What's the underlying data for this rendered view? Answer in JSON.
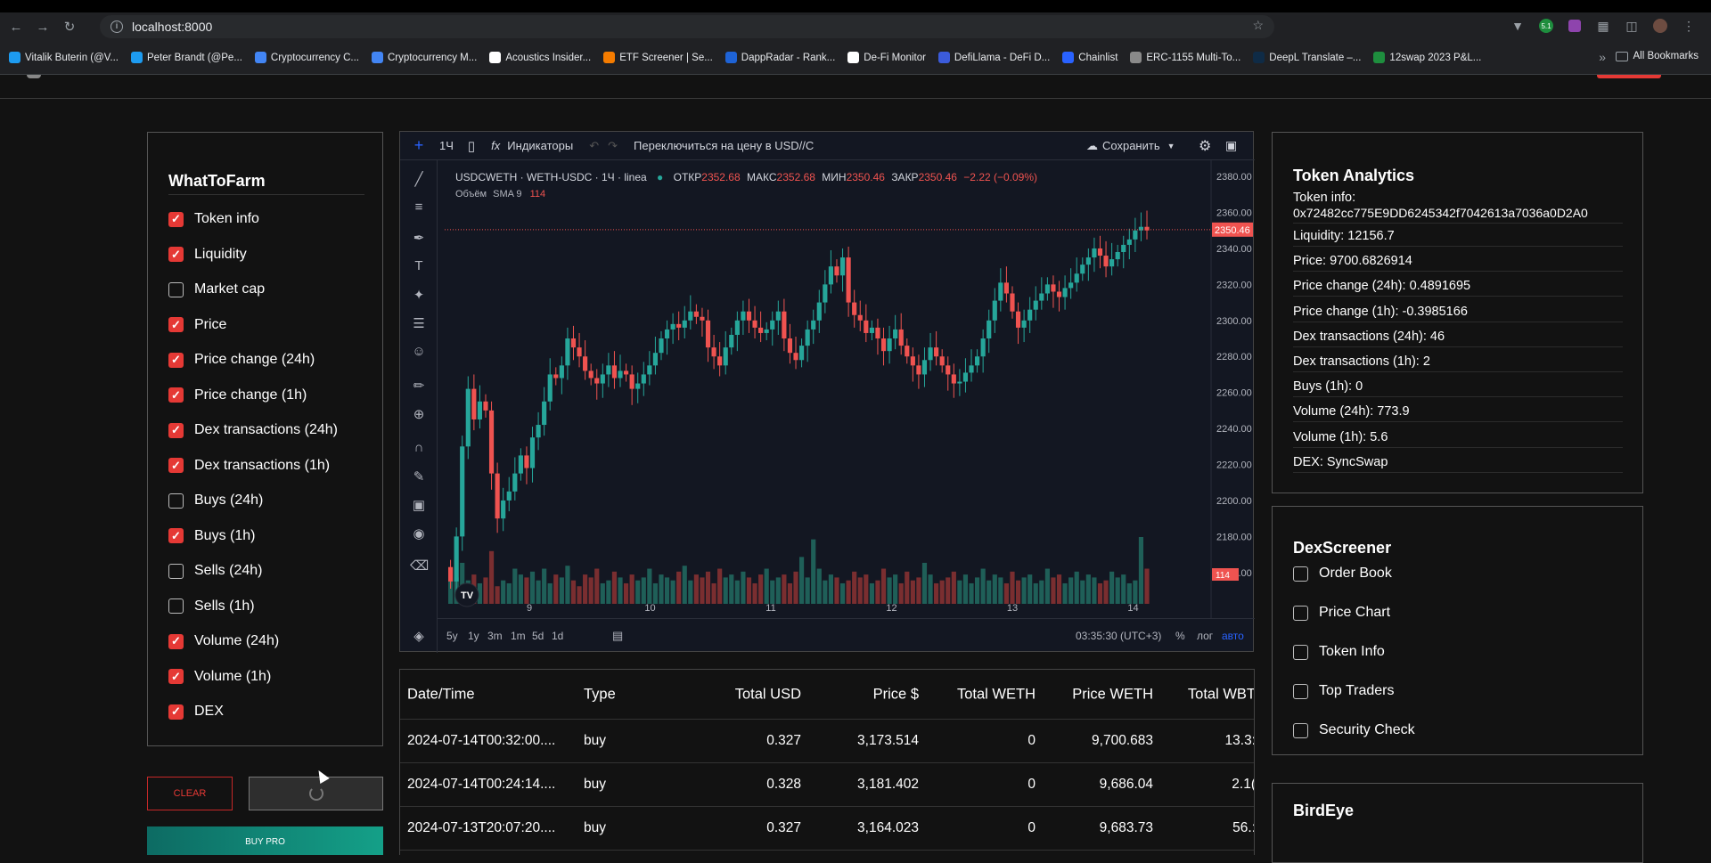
{
  "browser": {
    "url": "localhost:8000",
    "bookmarks": [
      "Vitalik Buterin (@V...",
      "Peter Brandt (@Pe...",
      "Cryptocurrency C...",
      "Cryptocurrency M...",
      "Acoustics Insider...",
      "ETF Screener | Se...",
      "DappRadar - Rank...",
      "De-Fi Monitor",
      "DefiLlama - DeFi D...",
      "Chainlist",
      "ERC-1155 Multi-To...",
      "DeepL Translate –...",
      "12swap 2023 P&L..."
    ],
    "bookmark_colors": [
      "#1d9bf0",
      "#1d9bf0",
      "#4285f4",
      "#4285f4",
      "#ffffff",
      "#f57c00",
      "#1e63d6",
      "#ffffff",
      "#3b5bdb",
      "#2962ff",
      "#8a8a8a",
      "#0f2b46",
      "#1e8e3e"
    ],
    "all_bookmarks": "All Bookmarks",
    "ext_badge": "5.1"
  },
  "whattofarm": {
    "title": "WhatToFarm",
    "items": [
      {
        "label": "Token info",
        "checked": true
      },
      {
        "label": "Liquidity",
        "checked": true
      },
      {
        "label": "Market cap",
        "checked": false
      },
      {
        "label": "Price",
        "checked": true
      },
      {
        "label": "Price change (24h)",
        "checked": true
      },
      {
        "label": "Price change (1h)",
        "checked": true
      },
      {
        "label": "Dex transactions (24h)",
        "checked": true
      },
      {
        "label": "Dex transactions (1h)",
        "checked": true
      },
      {
        "label": "Buys (24h)",
        "checked": false
      },
      {
        "label": "Buys (1h)",
        "checked": true
      },
      {
        "label": "Sells (24h)",
        "checked": false
      },
      {
        "label": "Sells (1h)",
        "checked": false
      },
      {
        "label": "Volume (24h)",
        "checked": true
      },
      {
        "label": "Volume (1h)",
        "checked": true
      },
      {
        "label": "DEX",
        "checked": true
      }
    ],
    "clear_label": "CLEAR",
    "pro_label": "BUY PRO"
  },
  "chart": {
    "interval": "1Ч",
    "indicators": "Индикаторы",
    "switch_price": "Переключиться на цену в USD//C",
    "save": "Сохранить",
    "symbol": "USDCWETH · WETH-USDC · 1Ч · linea",
    "ohlc_o_label": "ОТКР",
    "ohlc_o": "2352.68",
    "ohlc_h_label": "МАКС",
    "ohlc_h": "2352.68",
    "ohlc_l_label": "МИН",
    "ohlc_l": "2350.46",
    "ohlc_c_label": "ЗАКР",
    "ohlc_c": "2350.46",
    "change": "−2.22 (−0.09%)",
    "volume_label": "Объём",
    "sma_label": "SMA 9",
    "sma_value": "114",
    "last_price": "2350.46",
    "last_volume": "114",
    "timeframes": [
      "5y",
      "1y",
      "3m",
      "1m",
      "5d",
      "1d"
    ],
    "time": "03:35:30 (UTC+3)",
    "percent": "%",
    "log": "лог",
    "auto": "авто",
    "y_ticks": [
      "2380.00",
      "2360.00",
      "2340.00",
      "2320.00",
      "2300.00",
      "2280.00",
      "2260.00",
      "2240.00",
      "2220.00",
      "2200.00",
      "2180.00",
      "2160.00"
    ],
    "x_ticks": [
      "9",
      "10",
      "11",
      "12",
      "13",
      "14"
    ],
    "up_color": "#26a69a",
    "down_color": "#ef5350"
  },
  "chart_data": {
    "type": "candlestick",
    "ylim": [
      2150,
      2385
    ],
    "x_range": [
      "2024-07-08",
      "2024-07-14"
    ],
    "closes": [
      2155,
      2180,
      2230,
      2262,
      2245,
      2255,
      2250,
      2215,
      2190,
      2200,
      2205,
      2215,
      2225,
      2218,
      2235,
      2242,
      2255,
      2270,
      2268,
      2275,
      2290,
      2285,
      2280,
      2272,
      2268,
      2265,
      2270,
      2275,
      2268,
      2272,
      2270,
      2262,
      2265,
      2270,
      2275,
      2282,
      2290,
      2295,
      2298,
      2296,
      2300,
      2305,
      2302,
      2300,
      2285,
      2280,
      2275,
      2285,
      2292,
      2300,
      2305,
      2300,
      2296,
      2293,
      2295,
      2300,
      2305,
      2290,
      2282,
      2278,
      2286,
      2295,
      2300,
      2310,
      2320,
      2330,
      2325,
      2335,
      2310,
      2303,
      2300,
      2293,
      2296,
      2290,
      2283,
      2290,
      2295,
      2286,
      2280,
      2275,
      2270,
      2278,
      2285,
      2280,
      2275,
      2270,
      2265,
      2266,
      2271,
      2275,
      2280,
      2290,
      2300,
      2311,
      2321,
      2315,
      2305,
      2296,
      2300,
      2306,
      2311,
      2315,
      2320,
      2316,
      2313,
      2318,
      2321,
      2326,
      2331,
      2335,
      2340,
      2336,
      2330,
      2334,
      2338,
      2342,
      2345,
      2350,
      2352,
      2350
    ],
    "volumes": [
      60,
      45,
      70,
      40,
      50,
      35,
      45,
      90,
      30,
      40,
      35,
      60,
      50,
      45,
      55,
      40,
      60,
      35,
      50,
      45,
      65,
      40,
      30,
      50,
      45,
      60,
      35,
      40,
      55,
      45,
      35,
      50,
      40,
      45,
      60,
      35,
      50,
      45,
      40,
      55,
      65,
      40,
      50,
      45,
      55,
      35,
      60,
      45,
      50,
      40,
      55,
      45,
      35,
      50,
      60,
      40,
      45,
      50,
      35,
      55,
      80,
      45,
      110,
      60,
      40,
      50,
      45,
      35,
      40,
      55,
      45,
      50,
      35,
      40,
      60,
      45,
      50,
      35,
      55,
      40,
      45,
      70,
      50,
      35,
      40,
      45,
      55,
      40,
      50,
      35,
      45,
      60,
      40,
      50,
      45,
      35,
      55,
      40,
      45,
      50,
      35,
      40,
      60,
      45,
      50,
      35,
      45,
      55,
      40,
      50,
      45,
      35,
      40,
      55,
      45,
      50,
      35,
      40,
      114,
      60
    ]
  },
  "trades": {
    "headers": [
      "Date/Time",
      "Type",
      "Total USD",
      "Price $",
      "Total WETH",
      "Price WETH",
      "Total WBT"
    ],
    "rows": [
      [
        "2024-07-14T00:32:00....",
        "buy",
        "0.327",
        "3,173.514",
        "0",
        "9,700.683",
        "13.3:"
      ],
      [
        "2024-07-14T00:24:14....",
        "buy",
        "0.328",
        "3,181.402",
        "0",
        "9,686.04",
        "2.1("
      ],
      [
        "2024-07-13T20:07:20....",
        "buy",
        "0.327",
        "3,164.023",
        "0",
        "9,683.73",
        "56.:"
      ]
    ]
  },
  "token_analytics": {
    "title": "Token Analytics",
    "token_info_label": "Token info:",
    "token_address": "0x72482cc775E9DD6245342f7042613a7036a0D2A0",
    "lines": [
      "Liquidity: 12156.7",
      "Price: 9700.6826914",
      "Price change (24h): 0.4891695",
      "Price change (1h): -0.3985166",
      "Dex transactions (24h): 46",
      "Dex transactions (1h): 2",
      "Buys (1h): 0",
      "Volume (24h): 773.9",
      "Volume (1h): 5.6",
      "DEX: SyncSwap"
    ]
  },
  "dexscreener": {
    "title": "DexScreener",
    "items": [
      {
        "label": "Order Book",
        "checked": false
      },
      {
        "label": "Price Chart",
        "checked": false
      },
      {
        "label": "Token Info",
        "checked": false
      },
      {
        "label": "Top Traders",
        "checked": false
      },
      {
        "label": "Security Check",
        "checked": false
      }
    ]
  },
  "birdeye": {
    "title": "BirdEye"
  }
}
